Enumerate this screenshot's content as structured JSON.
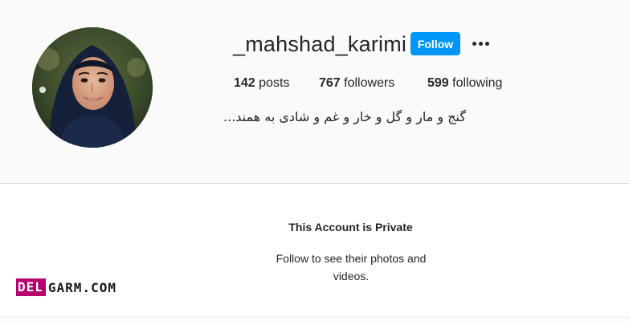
{
  "profile": {
    "username": "_mahshad_karimi",
    "follow_label": "Follow",
    "more_options_icon": "more-horizontal-icon",
    "bio": "گنج و مار و گل و خار و غم و شادی به همند...",
    "stats": {
      "posts_count": "142",
      "posts_label": "posts",
      "followers_count": "767",
      "followers_label": "followers",
      "following_count": "599",
      "following_label": "following"
    }
  },
  "private_notice": {
    "title": "This Account is Private",
    "subtitle": "Follow to see their photos and videos."
  },
  "watermark": {
    "boxed": "DEL",
    "text": "GARM.COM",
    "color": "#b5006e"
  },
  "colors": {
    "accent": "#0095f6",
    "text": "#262626",
    "background": "#fafafa"
  }
}
